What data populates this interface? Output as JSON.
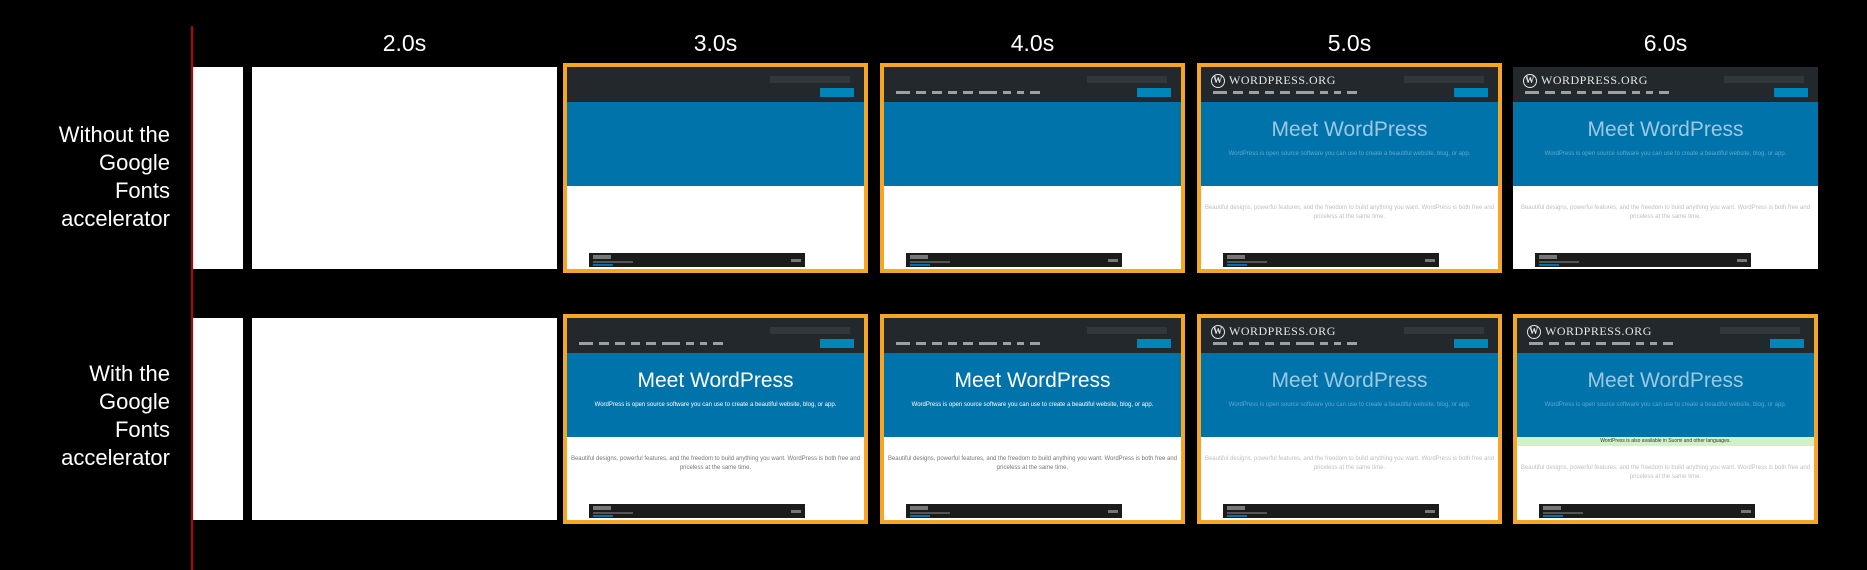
{
  "timestamps": [
    "2.0s",
    "3.0s",
    "4.0s",
    "5.0s",
    "6.0s"
  ],
  "rows": [
    {
      "label": "Without the Google Fonts accelerator",
      "frames": [
        {
          "time": "3.0s",
          "state": "bar-only",
          "changed": true
        },
        {
          "time": "4.0s",
          "state": "nav-no-text",
          "changed": true
        },
        {
          "time": "5.0s",
          "state": "full-faded",
          "changed": true
        },
        {
          "time": "6.0s",
          "state": "full-faded",
          "changed": false
        }
      ]
    },
    {
      "label": "With the Google Fonts accelerator",
      "frames": [
        {
          "time": "3.0s",
          "state": "full",
          "changed": true
        },
        {
          "time": "4.0s",
          "state": "full",
          "changed": true
        },
        {
          "time": "5.0s",
          "state": "full-faded",
          "changed": true
        },
        {
          "time": "6.0s",
          "state": "full-faded-notice",
          "changed": true
        }
      ]
    }
  ],
  "site": {
    "logo_text": "WORDPRESS.ORG",
    "logo_glyph": "W",
    "hero_title": "Meet WordPress",
    "hero_subtitle": "WordPress is open source software you can use to create a beautiful website, blog, or app.",
    "body_text": "Beautiful designs, powerful features, and the freedom to build anything you want. WordPress is both free and priceless at the same time.",
    "notice_text": "WordPress is also available in Suomi and other languages."
  },
  "colors": {
    "background": "#000000",
    "timeline_line": "#c00000",
    "change_highlight": "#f5a623",
    "wp_header": "#23282d",
    "wp_blue": "#0073aa"
  }
}
